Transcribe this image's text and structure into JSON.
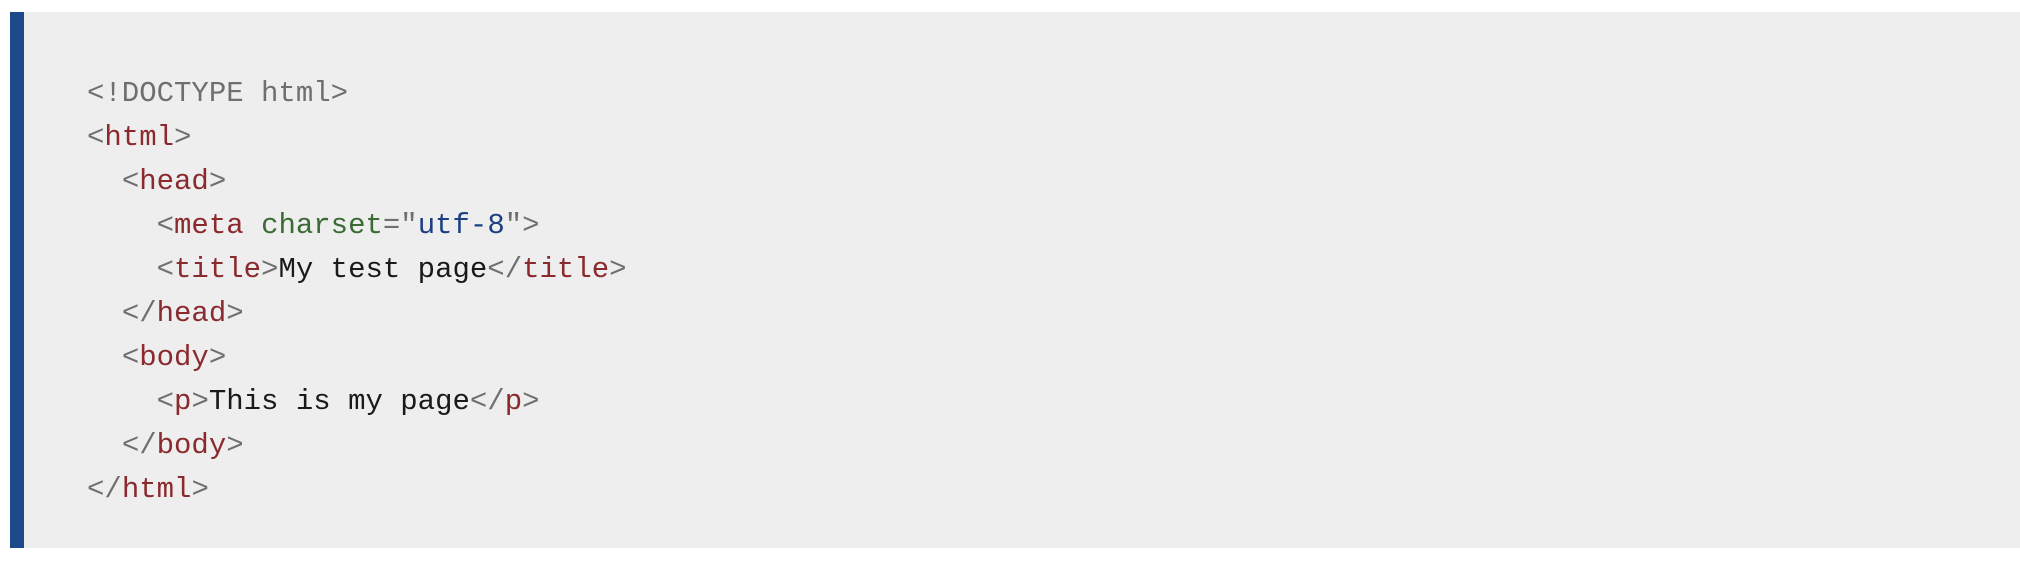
{
  "code": {
    "doctype": "<!DOCTYPE html>",
    "lines": [
      {
        "indent": "",
        "lt": "<",
        "tag": "html",
        "gt": ">"
      },
      {
        "indent": "  ",
        "lt": "<",
        "tag": "head",
        "gt": ">"
      },
      {
        "indent": "    ",
        "lt": "<",
        "tag": "meta",
        "space": " ",
        "attr": "charset",
        "eq": "=",
        "q1": "\"",
        "val": "utf-8",
        "q2": "\"",
        "gt": ">"
      },
      {
        "indent": "    ",
        "lt": "<",
        "tag": "title",
        "gt": ">",
        "text": "My test page",
        "lt_close": "</",
        "close_tag": "title",
        "gt_close": ">"
      },
      {
        "indent": "  ",
        "lt": "</",
        "tag": "head",
        "gt": ">"
      },
      {
        "indent": "  ",
        "lt": "<",
        "tag": "body",
        "gt": ">"
      },
      {
        "indent": "    ",
        "lt": "<",
        "tag": "p",
        "gt": ">",
        "text": "This is my page",
        "lt_close": "</",
        "close_tag": "p",
        "gt_close": ">"
      },
      {
        "indent": "  ",
        "lt": "</",
        "tag": "body",
        "gt": ">"
      },
      {
        "indent": "",
        "lt": "</",
        "tag": "html",
        "gt": ">"
      }
    ]
  },
  "colors": {
    "accent_bar": "#1f4a8a",
    "background": "#eeeeee",
    "tag": "#8a2a2e",
    "attribute": "#3a6b35",
    "value": "#1c3f84",
    "punctuation": "#6f6f6f",
    "text": "#1a1a1a"
  }
}
